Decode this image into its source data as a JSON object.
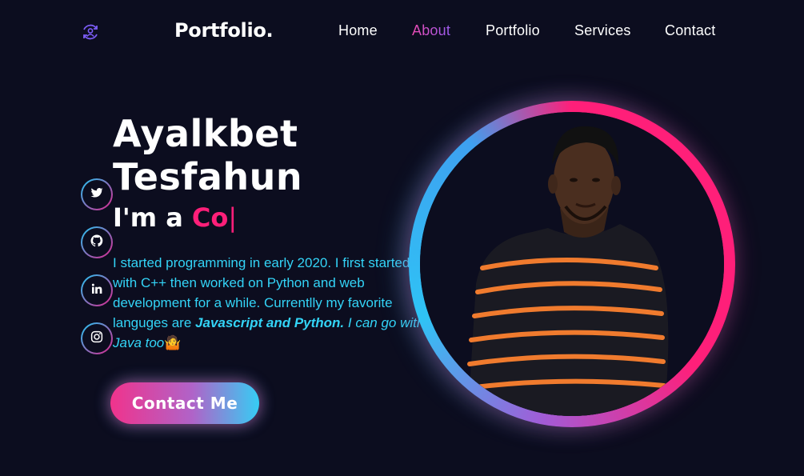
{
  "nav": {
    "brand": "Portfolio.",
    "links": [
      "Home",
      "About",
      "Portfolio",
      "Services",
      "Contact"
    ],
    "active": "About",
    "logo_icon": "user-sync-icon"
  },
  "social": [
    {
      "name": "twitter-icon"
    },
    {
      "name": "github-icon"
    },
    {
      "name": "linkedin-icon"
    },
    {
      "name": "instagram-icon"
    }
  ],
  "hero": {
    "first_name": "Ayalkbet",
    "last_name": "Tesfahun",
    "role_prefix": "I'm a",
    "role_typed": "Co",
    "caret": "|",
    "bio_1": "I started programming in early 2020. I first started with C++ then worked on Python and web development for a while. Currentlly my favorite languges are ",
    "bio_bold": "Javascript and Python.",
    "bio_2": " I can go with Java too",
    "bio_emoji": "🤷",
    "cta_label": "Contact Me"
  },
  "colors": {
    "background": "#0c0d1f",
    "accent_pink": "#ff1f79",
    "accent_cyan": "#33d4f7"
  }
}
